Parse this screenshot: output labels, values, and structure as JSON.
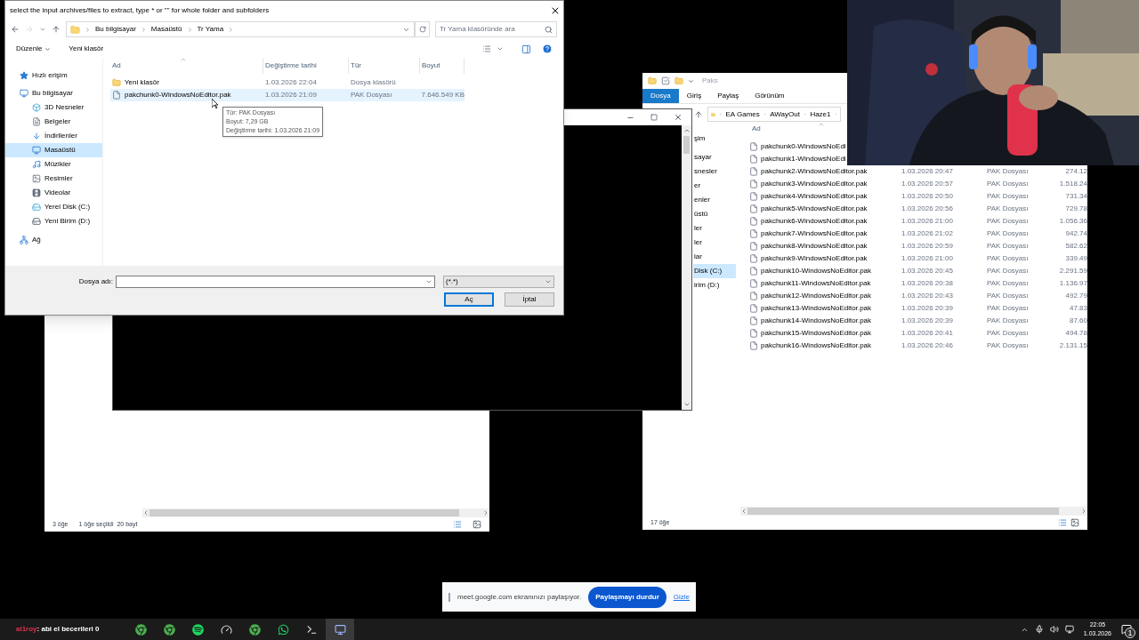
{
  "dialog": {
    "title": "select the input archives/files to extract, type * or \"\" for whole folder and subfolders",
    "breadcrumb": [
      "Bu bilgisayar",
      "Masaüstü",
      "Tr Yama"
    ],
    "search_placeholder": "Tr Yama klasöründe ara",
    "toolbar": [
      "Düzenle",
      "Yeni klasör"
    ],
    "nav": [
      {
        "label": "Hızlı erişim",
        "kind": "star",
        "selected": false
      },
      {
        "label": "Bu bilgisayar",
        "kind": "pc",
        "selected": false,
        "children": [
          {
            "label": "3D Nesneler",
            "kind": "cube",
            "selected": false
          },
          {
            "label": "Belgeler",
            "kind": "docs",
            "selected": false
          },
          {
            "label": "İndirilenler",
            "kind": "download",
            "selected": false
          },
          {
            "label": "Masaüstü",
            "kind": "desktop",
            "selected": true
          },
          {
            "label": "Müzikler",
            "kind": "music",
            "selected": false
          },
          {
            "label": "Resimler",
            "kind": "pictures",
            "selected": false
          },
          {
            "label": "Videolar",
            "kind": "video",
            "selected": false
          },
          {
            "label": "Yerel Disk (C:)",
            "kind": "disk",
            "selected": false
          },
          {
            "label": "Yeni Birim (D:)",
            "kind": "drive",
            "selected": false
          }
        ]
      },
      {
        "label": "Ağ",
        "kind": "network",
        "selected": false
      }
    ],
    "columns": [
      "Ad",
      "Değiştirme tarihi",
      "Tür",
      "Boyut"
    ],
    "rows": [
      {
        "kind": "folder",
        "name": "Yeni klasör",
        "date": "1.03.2026 22:04",
        "type": "Dosya klasörü",
        "selected": false
      },
      {
        "kind": "file",
        "name": "pakchunk0-WindowsNoEditor.pak",
        "date": "1.03.2026 21:09",
        "type": "PAK Dosyası",
        "size": "7.646.549 KB",
        "selected": true
      }
    ],
    "tooltip": [
      "Tür: PAK Dosyası",
      "Boyut: 7,29 GB",
      "Değiştirme tarihi: 1.03.2026 21:09"
    ],
    "file_name_label": "Dosya adı:",
    "filter": "(*.*)",
    "buttons": [
      {
        "label": "Aç",
        "default": true
      },
      {
        "label": "İptal",
        "default": false
      }
    ]
  },
  "back_window": {
    "status": [
      "3 öğe",
      "1 öğe seçildi",
      "20 bayt"
    ]
  },
  "explorer": {
    "title": "Paks",
    "ribbon_tabs": [
      {
        "label": "Dosya",
        "selected": true
      },
      {
        "label": "Giriş",
        "selected": false
      },
      {
        "label": "Paylaş",
        "selected": false
      },
      {
        "label": "Görünüm",
        "selected": false
      }
    ],
    "breadcrumb": [
      "EA Games",
      "AWayOut",
      "Haze1"
    ],
    "nav": [
      {
        "label": "şim",
        "selected": false
      },
      {
        "label": "sayar",
        "selected": false
      },
      {
        "label": "snesler",
        "selected": false
      },
      {
        "label": "er",
        "selected": false
      },
      {
        "label": "enler",
        "selected": false
      },
      {
        "label": "üstü",
        "selected": false
      },
      {
        "label": "ler",
        "selected": false
      },
      {
        "label": "ler",
        "selected": false
      },
      {
        "label": "lar",
        "selected": false
      },
      {
        "label": "Disk (C:)",
        "selected": true
      },
      {
        "label": "irim (D:)",
        "selected": false
      }
    ],
    "column": "Ad",
    "files": [
      {
        "name": "pakchunk0-WindowsNoEdi"
      },
      {
        "name": "pakchunk1-WindowsNoEdi"
      },
      {
        "name": "pakchunk2-WindowsNoEditor.pak",
        "date": "1.03.2026 20:47",
        "type": "PAK Dosyası",
        "size": "274.12"
      },
      {
        "name": "pakchunk3-WindowsNoEditor.pak",
        "date": "1.03.2026 20:57",
        "type": "PAK Dosyası",
        "size": "1.518.24"
      },
      {
        "name": "pakchunk4-WindowsNoEditor.pak",
        "date": "1.03.2026 20:50",
        "type": "PAK Dosyası",
        "size": "731.34"
      },
      {
        "name": "pakchunk5-WindowsNoEditor.pak",
        "date": "1.03.2026 20:56",
        "type": "PAK Dosyası",
        "size": "729.78"
      },
      {
        "name": "pakchunk6-WindowsNoEditor.pak",
        "date": "1.03.2026 21:00",
        "type": "PAK Dosyası",
        "size": "1.056.36"
      },
      {
        "name": "pakchunk7-WindowsNoEditor.pak",
        "date": "1.03.2026 21:02",
        "type": "PAK Dosyası",
        "size": "942.74"
      },
      {
        "name": "pakchunk8-WindowsNoEditor.pak",
        "date": "1.03.2026 20:59",
        "type": "PAK Dosyası",
        "size": "582.62"
      },
      {
        "name": "pakchunk9-WindowsNoEditor.pak",
        "date": "1.03.2026 21:00",
        "type": "PAK Dosyası",
        "size": "339.49"
      },
      {
        "name": "pakchunk10-WindowsNoEditor.pak",
        "date": "1.03.2026 20:45",
        "type": "PAK Dosyası",
        "size": "2.291.59"
      },
      {
        "name": "pakchunk11-WindowsNoEditor.pak",
        "date": "1.03.2026 20:38",
        "type": "PAK Dosyası",
        "size": "1.136.97"
      },
      {
        "name": "pakchunk12-WindowsNoEditor.pak",
        "date": "1.03.2026 20:43",
        "type": "PAK Dosyası",
        "size": "492.79"
      },
      {
        "name": "pakchunk13-WindowsNoEditor.pak",
        "date": "1.03.2026 20:39",
        "type": "PAK Dosyası",
        "size": "47.83"
      },
      {
        "name": "pakchunk14-WindowsNoEditor.pak",
        "date": "1.03.2026 20:39",
        "type": "PAK Dosyası",
        "size": "87.60"
      },
      {
        "name": "pakchunk15-WindowsNoEditor.pak",
        "date": "1.03.2026 20:41",
        "type": "PAK Dosyası",
        "size": "494.78"
      },
      {
        "name": "pakchunk16-WindowsNoEditor.pak",
        "date": "1.03.2026 20:46",
        "type": "PAK Dosyası",
        "size": "2.131.15"
      }
    ],
    "status": "17 öğe"
  },
  "share_bar": {
    "message": "meet.google.com ekranınızı paylaşıyor.",
    "stop_button": "Paylaşmayı durdur",
    "hide_link": "Gizle"
  },
  "stream_chat": {
    "user": "al1roy",
    "message": ": abi el becerileri 0"
  },
  "taskbar": {
    "apps": [
      {
        "kind": "chrome",
        "active": false
      },
      {
        "kind": "chrome",
        "active": false
      },
      {
        "kind": "spotify",
        "active": false
      },
      {
        "kind": "gauge",
        "active": false
      },
      {
        "kind": "chrome",
        "active": false
      },
      {
        "kind": "whatsapp",
        "active": false
      },
      {
        "kind": "terminal",
        "active": false
      },
      {
        "kind": "app",
        "active": true
      }
    ],
    "time": "22:05",
    "date": "1.03.2026",
    "notifications": "1"
  }
}
